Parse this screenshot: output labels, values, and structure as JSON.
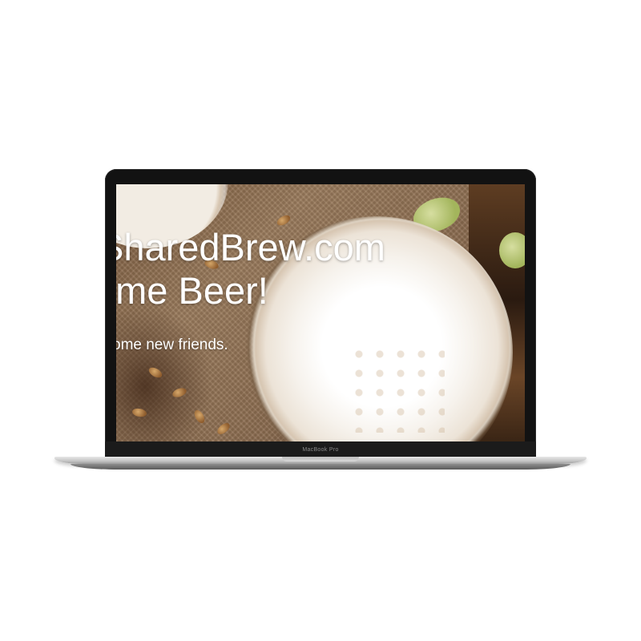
{
  "hero": {
    "title_line1": "SharedBrew.com",
    "title_line2": "ome Beer!",
    "subtitle": "ome new friends."
  },
  "device": {
    "model_label": "MacBook Pro"
  }
}
